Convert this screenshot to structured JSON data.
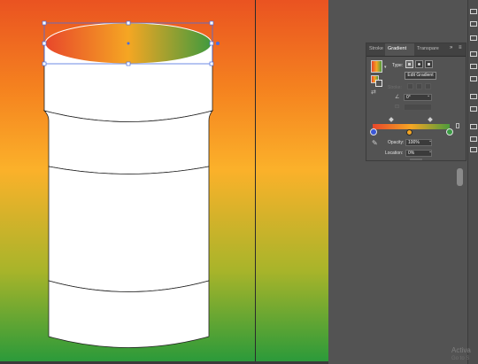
{
  "panel": {
    "tabs": [
      {
        "label": "Stroke",
        "active": false
      },
      {
        "label": "Gradient",
        "active": true
      },
      {
        "label": "Transpare",
        "active": false
      }
    ],
    "menu_collapse": "»",
    "menu_icon": "≡",
    "type_label": "Type:",
    "edit_gradient": "Edit Gradient",
    "stroke_label": "Stroke:",
    "angle_value": "0°",
    "opacity_label": "Opacity:",
    "opacity_value": "100%",
    "location_label": "Location:",
    "location_value": "0%",
    "dropdown_caret": "⌄"
  },
  "colors": {
    "gradient_start": "#e8472b",
    "gradient_mid": "#f5a623",
    "gradient_end": "#4c9b3c",
    "artboard_top": "#ea5321",
    "artboard_bottom": "#2b9a3a",
    "selection_blue": "#4a6ee0"
  },
  "watermark": {
    "line1": "Activa",
    "line2": "Go to S"
  }
}
